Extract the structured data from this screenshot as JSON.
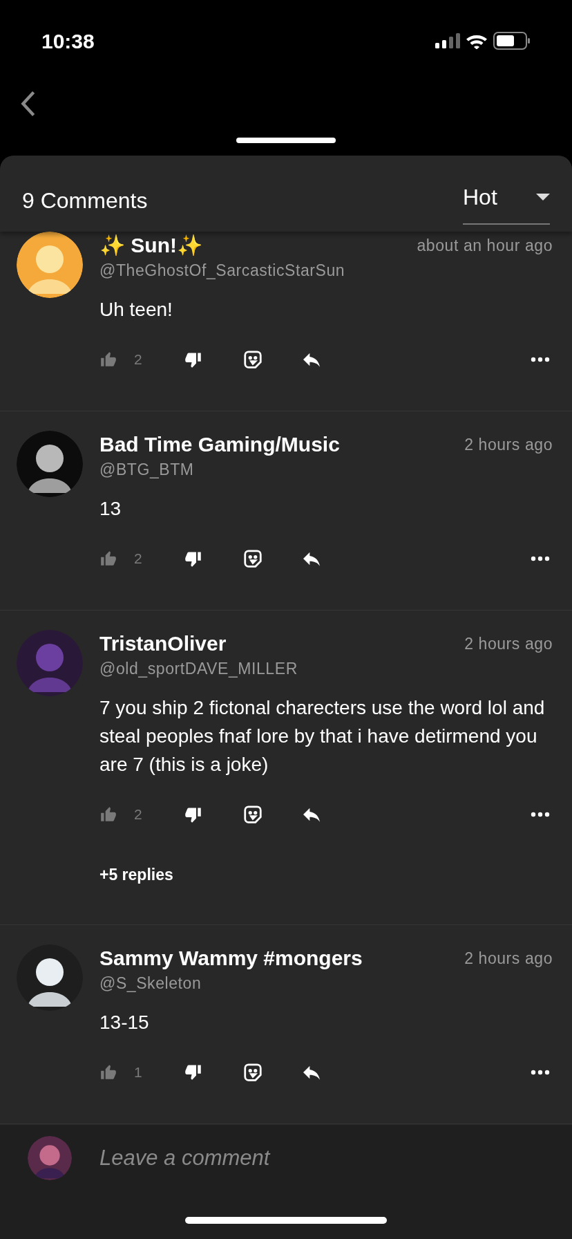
{
  "status_bar": {
    "time": "10:38"
  },
  "header": {
    "title": "9 Comments",
    "sort": "Hot"
  },
  "comments": [
    {
      "name": "✨ Sun!✨",
      "handle": "@TheGhostOf_SarcasticStarSun",
      "time": "about an hour ago",
      "body": "Uh teen!",
      "likes": "2"
    },
    {
      "name": "Bad Time Gaming/Music",
      "handle": "@BTG_BTM",
      "time": "2 hours ago",
      "body": "13",
      "likes": "2"
    },
    {
      "name": "TristanOliver",
      "handle": "@old_sportDAVE_MILLER",
      "time": "2 hours ago",
      "body": "7 you ship 2 fictonal charecters use the word lol and steal peoples fnaf lore by that i have detirmend you are 7 (this is a joke)",
      "likes": "2",
      "replies": "+5 replies"
    },
    {
      "name": "Sammy Wammy #mongers",
      "handle": "@S_Skeleton",
      "time": "2 hours ago",
      "body": "13-15",
      "likes": "1"
    }
  ],
  "composer": {
    "placeholder": "Leave a comment"
  }
}
